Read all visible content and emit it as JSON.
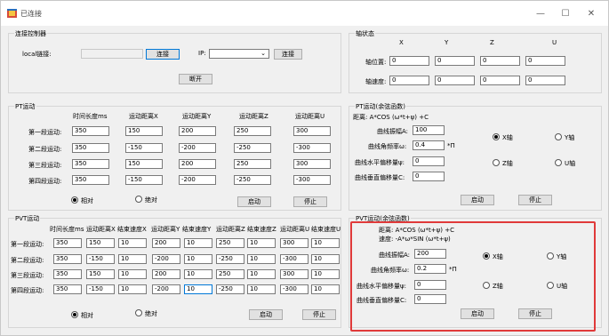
{
  "window": {
    "title": "已连接",
    "min": "—",
    "max": "☐",
    "close": "✕"
  },
  "connect": {
    "title": "连接控制器",
    "local_label": "local链接:",
    "local_value": "",
    "connect_btn": "连接",
    "ip_label": "IP:",
    "ip_value": "",
    "ip_connect_btn": "连接",
    "open_btn": "断开"
  },
  "axis": {
    "title": "轴状态",
    "cols": [
      "X",
      "Y",
      "Z",
      "U"
    ],
    "pos_label": "轴位置:",
    "vel_label": "轴速度:",
    "pos": [
      "0",
      "0",
      "0",
      "0"
    ],
    "vel": [
      "0",
      "0",
      "0",
      "0"
    ]
  },
  "pt": {
    "title": "PT运动",
    "headers": [
      "时间长度ms",
      "运动距离X",
      "运动距离Y",
      "运动距离Z",
      "运动距离U"
    ],
    "rows": [
      {
        "label": "第一段运动:",
        "vals": [
          "350",
          "150",
          "200",
          "250",
          "300"
        ]
      },
      {
        "label": "第二段运动:",
        "vals": [
          "350",
          "-150",
          "-200",
          "-250",
          "-300"
        ]
      },
      {
        "label": "第三段运动:",
        "vals": [
          "350",
          "150",
          "200",
          "250",
          "300"
        ]
      },
      {
        "label": "第四段运动:",
        "vals": [
          "350",
          "-150",
          "-200",
          "-250",
          "-300"
        ]
      }
    ],
    "relative": "相对",
    "absolute": "绝对",
    "start": "启动",
    "stop": "停止"
  },
  "ptcos": {
    "title": "PT运动(余弦函数)",
    "formula": "距离: A*COS (ω*t+ψ) +C",
    "amp_label": "曲线振幅A:",
    "amp": "100",
    "freq_label": "曲线角频率ω:",
    "freq": "0.4",
    "freq_unit": "*Π",
    "phase_label": "曲线水平偏移量ψ:",
    "phase": "0",
    "offset_label": "曲线垂直偏移量C:",
    "offset": "0",
    "xaxis": "X轴",
    "yaxis": "Y轴",
    "zaxis": "Z轴",
    "uaxis": "U轴",
    "start": "启动",
    "stop": "停止"
  },
  "pvt": {
    "title": "PVT运动",
    "headers": [
      "时间长度ms",
      "运动距离X",
      "结束速度X",
      "运动距离Y",
      "结束速度Y",
      "运动距离Z",
      "结束速度Z",
      "运动距离U",
      "结束速度U"
    ],
    "rows": [
      {
        "label": "第一段运动:",
        "vals": [
          "350",
          "150",
          "10",
          "200",
          "10",
          "250",
          "10",
          "300",
          "10"
        ]
      },
      {
        "label": "第二段运动:",
        "vals": [
          "350",
          "-150",
          "10",
          "-200",
          "10",
          "-250",
          "10",
          "-300",
          "10"
        ]
      },
      {
        "label": "第三段运动:",
        "vals": [
          "350",
          "150",
          "10",
          "200",
          "10",
          "250",
          "10",
          "300",
          "10"
        ]
      },
      {
        "label": "第四段运动:",
        "vals": [
          "350",
          "-150",
          "10",
          "-200",
          "10",
          "-250",
          "10",
          "-300",
          "10"
        ]
      }
    ],
    "relative": "相对",
    "absolute": "绝对",
    "start": "启动",
    "stop": "停止"
  },
  "pvtcos": {
    "title": "PVT运动(余弦函数)",
    "formula1": "距离: A*COS (ω*t+ψ) +C",
    "formula2": "速度: -A*ω*SIN (ω*t+ψ)",
    "amp_label": "曲线振幅A:",
    "amp": "200",
    "freq_label": "曲线角频率ω:",
    "freq": "0.2",
    "freq_unit": "*Π",
    "phase_label": "曲线水平偏移量ψ:",
    "phase": "0",
    "offset_label": "曲线垂直偏移量C:",
    "offset": "0",
    "xaxis": "X轴",
    "yaxis": "Y轴",
    "zaxis": "Z轴",
    "uaxis": "U轴",
    "start": "启动",
    "stop": "停止"
  }
}
